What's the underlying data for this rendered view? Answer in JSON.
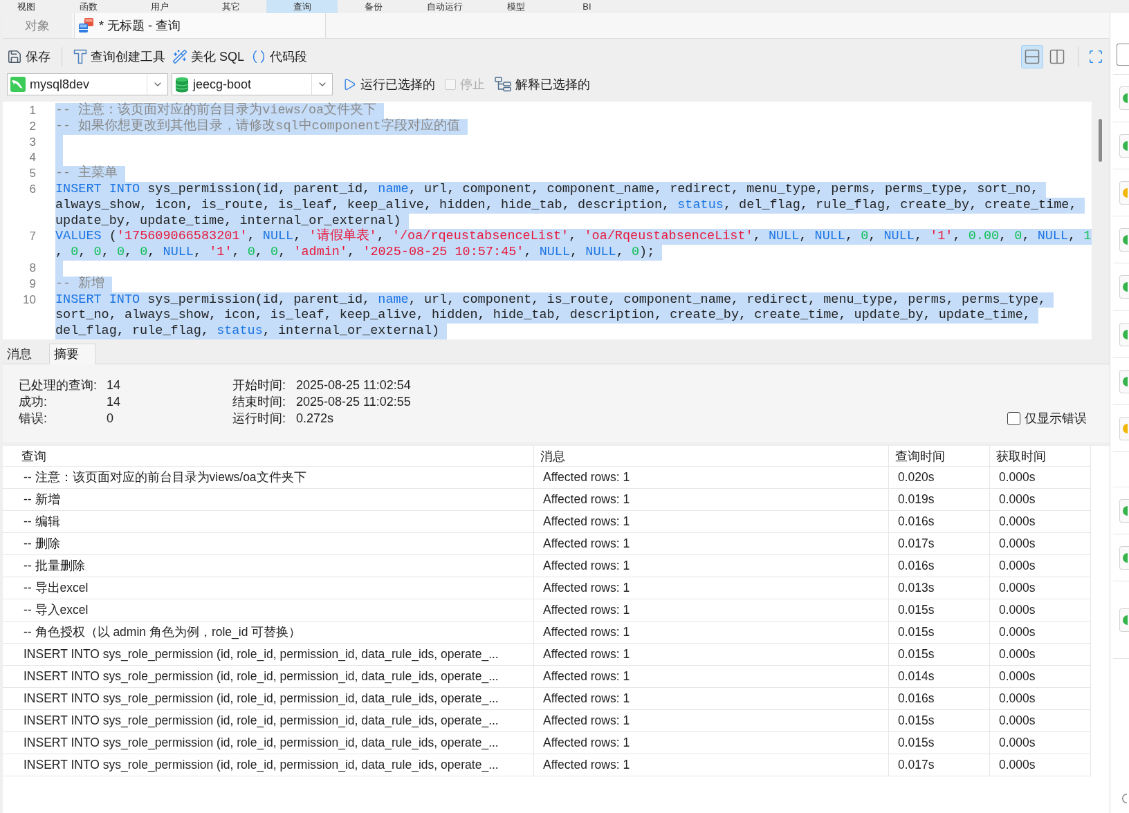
{
  "menu_bar": {
    "items": [
      {
        "label": "视图",
        "selected": false
      },
      {
        "label": "函数",
        "selected": false
      },
      {
        "label": "用户",
        "selected": false
      },
      {
        "label": "其它",
        "selected": false
      },
      {
        "label": "查询",
        "selected": true
      },
      {
        "label": "备份",
        "selected": false
      },
      {
        "label": "自动运行",
        "selected": false
      },
      {
        "label": "模型",
        "selected": false
      },
      {
        "label": "BI",
        "selected": false
      }
    ]
  },
  "document_tabs": [
    {
      "kind": "objects",
      "label": "对象",
      "selected": false
    },
    {
      "kind": "query",
      "label": "* 无标题 - 查询",
      "selected": true
    }
  ],
  "toolbar": {
    "buttons": [
      {
        "kind": "save",
        "label": "保存"
      },
      {
        "kind": "builder",
        "label": "查询创建工具"
      },
      {
        "kind": "beautify",
        "label": "美化 SQL"
      },
      {
        "kind": "snippet",
        "label": "代码段"
      }
    ],
    "layout_buttons": [
      {
        "kind": "split-horizontal",
        "selected": true
      },
      {
        "kind": "split-vertical",
        "selected": false
      }
    ]
  },
  "query_bar": {
    "connection": "mysql8dev",
    "database": "jeecg-boot",
    "actions": [
      {
        "kind": "run",
        "label": "运行已选择的",
        "disabled": false
      },
      {
        "kind": "stop",
        "label": "停止",
        "disabled": true
      },
      {
        "kind": "explain",
        "label": "解释已选择的",
        "disabled": false
      }
    ]
  },
  "editor": {
    "selected": true,
    "lines": [
      {
        "number": "1",
        "wrapped_lines": [
          {
            "spans": [
              {
                "kind": "comment",
                "text": "-- 注意：该页面对应的前台目录为views/oa文件夹下"
              }
            ]
          }
        ]
      },
      {
        "number": "2",
        "wrapped_lines": [
          {
            "spans": [
              {
                "kind": "comment",
                "text": "-- 如果你想更改到其他目录，请修改sql中component字段对应的值"
              }
            ]
          }
        ]
      },
      {
        "number": "3"
      },
      {
        "number": "4"
      },
      {
        "number": "5",
        "wrapped_lines": [
          {
            "spans": [
              {
                "kind": "comment",
                "text": "-- 主菜单"
              }
            ]
          }
        ]
      },
      {
        "number": "6",
        "wrapped_lines": [
          {
            "spans": [
              {
                "kind": "keyword",
                "text": "INSERT INTO"
              },
              {
                "kind": "plain",
                "text": " sys_permission(id, parent_id, "
              },
              {
                "kind": "keyword",
                "text": "name"
              },
              {
                "kind": "plain",
                "text": ", url, component, component_name, redirect, menu_type, perms, perms_type, sort_no,"
              }
            ]
          },
          {
            "spans": [
              {
                "kind": "plain",
                "text": "always_show, icon, is_route, is_leaf, keep_alive, hidden, hide_tab, description, "
              },
              {
                "kind": "keyword",
                "text": "status"
              },
              {
                "kind": "plain",
                "text": ", del_flag, rule_flag, create_by, create_time,"
              }
            ]
          },
          {
            "spans": [
              {
                "kind": "plain",
                "text": "update_by, update_time, internal_or_external)"
              }
            ]
          }
        ]
      },
      {
        "number": "7",
        "wrapped_lines": [
          {
            "spans": [
              {
                "kind": "keyword",
                "text": "VALUES"
              },
              {
                "kind": "plain",
                "text": " ("
              },
              {
                "kind": "string",
                "text": "'175609066583201'"
              },
              {
                "kind": "plain",
                "text": ", "
              },
              {
                "kind": "keyword",
                "text": "NULL"
              },
              {
                "kind": "plain",
                "text": ", "
              },
              {
                "kind": "string",
                "text": "'请假单表'"
              },
              {
                "kind": "plain",
                "text": ", "
              },
              {
                "kind": "string",
                "text": "'/oa/rqeustabsenceList'"
              },
              {
                "kind": "plain",
                "text": ", "
              },
              {
                "kind": "string",
                "text": "'oa/RqeustabsenceList'"
              },
              {
                "kind": "plain",
                "text": ", "
              },
              {
                "kind": "keyword",
                "text": "NULL"
              },
              {
                "kind": "plain",
                "text": ", "
              },
              {
                "kind": "keyword",
                "text": "NULL"
              },
              {
                "kind": "plain",
                "text": ", "
              },
              {
                "kind": "number",
                "text": "0"
              },
              {
                "kind": "plain",
                "text": ", "
              },
              {
                "kind": "keyword",
                "text": "NULL"
              },
              {
                "kind": "plain",
                "text": ", "
              },
              {
                "kind": "string",
                "text": "'1'"
              },
              {
                "kind": "plain",
                "text": ", "
              },
              {
                "kind": "number",
                "text": "0.00"
              },
              {
                "kind": "plain",
                "text": ", "
              },
              {
                "kind": "number",
                "text": "0"
              },
              {
                "kind": "plain",
                "text": ", "
              },
              {
                "kind": "keyword",
                "text": "NULL"
              },
              {
                "kind": "plain",
                "text": ", "
              },
              {
                "kind": "number",
                "text": "1"
              }
            ]
          },
          {
            "spans": [
              {
                "kind": "plain",
                "text": ", "
              },
              {
                "kind": "number",
                "text": "0"
              },
              {
                "kind": "plain",
                "text": ", "
              },
              {
                "kind": "number",
                "text": "0"
              },
              {
                "kind": "plain",
                "text": ", "
              },
              {
                "kind": "number",
                "text": "0"
              },
              {
                "kind": "plain",
                "text": ", "
              },
              {
                "kind": "number",
                "text": "0"
              },
              {
                "kind": "plain",
                "text": ", "
              },
              {
                "kind": "keyword",
                "text": "NULL"
              },
              {
                "kind": "plain",
                "text": ", "
              },
              {
                "kind": "string",
                "text": "'1'"
              },
              {
                "kind": "plain",
                "text": ", "
              },
              {
                "kind": "number",
                "text": "0"
              },
              {
                "kind": "plain",
                "text": ", "
              },
              {
                "kind": "number",
                "text": "0"
              },
              {
                "kind": "plain",
                "text": ", "
              },
              {
                "kind": "string",
                "text": "'admin'"
              },
              {
                "kind": "plain",
                "text": ", "
              },
              {
                "kind": "string",
                "text": "'2025-08-25 10:57:45'"
              },
              {
                "kind": "plain",
                "text": ", "
              },
              {
                "kind": "keyword",
                "text": "NULL"
              },
              {
                "kind": "plain",
                "text": ", "
              },
              {
                "kind": "keyword",
                "text": "NULL"
              },
              {
                "kind": "plain",
                "text": ", "
              },
              {
                "kind": "number",
                "text": "0"
              },
              {
                "kind": "plain",
                "text": ");"
              }
            ]
          }
        ]
      },
      {
        "number": "8"
      },
      {
        "number": "9",
        "wrapped_lines": [
          {
            "spans": [
              {
                "kind": "comment",
                "text": "-- 新增"
              }
            ]
          }
        ]
      },
      {
        "number": "10",
        "wrapped_lines": [
          {
            "spans": [
              {
                "kind": "keyword",
                "text": "INSERT INTO"
              },
              {
                "kind": "plain",
                "text": " sys_permission(id, parent_id, "
              },
              {
                "kind": "keyword",
                "text": "name"
              },
              {
                "kind": "plain",
                "text": ", url, component, is_route, component_name, redirect, menu_type, perms, perms_type,"
              }
            ]
          },
          {
            "spans": [
              {
                "kind": "plain",
                "text": "sort_no, always_show, icon, is_leaf, keep_alive, hidden, hide_tab, description, create_by, create_time, update_by, update_time,"
              }
            ]
          },
          {
            "spans": [
              {
                "kind": "plain",
                "text": "del_flag, rule_flag, "
              },
              {
                "kind": "keyword",
                "text": "status"
              },
              {
                "kind": "plain",
                "text": ", internal_or_external)"
              }
            ]
          }
        ]
      }
    ]
  },
  "result_tabs": [
    {
      "label": "消息",
      "selected": false
    },
    {
      "label": "摘要",
      "selected": true
    }
  ],
  "summary": {
    "stats": [
      {
        "label": "已处理的查询:",
        "value": "14"
      },
      {
        "label": "成功:",
        "value": "14"
      },
      {
        "label": "错误:",
        "value": "0"
      }
    ],
    "times": [
      {
        "label": "开始时间:",
        "value": "2025-08-25 11:02:54"
      },
      {
        "label": "结束时间:",
        "value": "2025-08-25 11:02:55"
      },
      {
        "label": "运行时间:",
        "value": "0.272s"
      }
    ],
    "errors_only": {
      "label": "仅显示错误",
      "checked": false
    }
  },
  "results_table": {
    "columns": [
      "查询",
      "消息",
      "查询时间",
      "获取时间"
    ],
    "rows": [
      {
        "query": "-- 注意：该页面对应的前台目录为views/oa文件夹下",
        "message": "Affected rows: 1",
        "query_time": "0.020s",
        "fetch_time": "0.000s"
      },
      {
        "query": "-- 新增",
        "message": "Affected rows: 1",
        "query_time": "0.019s",
        "fetch_time": "0.000s"
      },
      {
        "query": "-- 编辑",
        "message": "Affected rows: 1",
        "query_time": "0.016s",
        "fetch_time": "0.000s"
      },
      {
        "query": "-- 删除",
        "message": "Affected rows: 1",
        "query_time": "0.017s",
        "fetch_time": "0.000s"
      },
      {
        "query": "-- 批量删除",
        "message": "Affected rows: 1",
        "query_time": "0.016s",
        "fetch_time": "0.000s"
      },
      {
        "query": "-- 导出excel",
        "message": "Affected rows: 1",
        "query_time": "0.013s",
        "fetch_time": "0.000s"
      },
      {
        "query": "-- 导入excel",
        "message": "Affected rows: 1",
        "query_time": "0.015s",
        "fetch_time": "0.000s"
      },
      {
        "query": "-- 角色授权（以 admin 角色为例，role_id 可替换）",
        "message": "Affected rows: 1",
        "query_time": "0.015s",
        "fetch_time": "0.000s"
      },
      {
        "query": "INSERT INTO sys_role_permission (id, role_id, permission_id, data_rule_ids, operate_...",
        "message": "Affected rows: 1",
        "query_time": "0.015s",
        "fetch_time": "0.000s"
      },
      {
        "query": "INSERT INTO sys_role_permission (id, role_id, permission_id, data_rule_ids, operate_...",
        "message": "Affected rows: 1",
        "query_time": "0.014s",
        "fetch_time": "0.000s"
      },
      {
        "query": "INSERT INTO sys_role_permission (id, role_id, permission_id, data_rule_ids, operate_...",
        "message": "Affected rows: 1",
        "query_time": "0.016s",
        "fetch_time": "0.000s"
      },
      {
        "query": "INSERT INTO sys_role_permission (id, role_id, permission_id, data_rule_ids, operate_...",
        "message": "Affected rows: 1",
        "query_time": "0.015s",
        "fetch_time": "0.000s"
      },
      {
        "query": "INSERT INTO sys_role_permission (id, role_id, permission_id, data_rule_ids, operate_...",
        "message": "Affected rows: 1",
        "query_time": "0.015s",
        "fetch_time": "0.000s"
      },
      {
        "query": "INSERT INTO sys_role_permission (id, role_id, permission_id, data_rule_ids, operate_...",
        "message": "Affected rows: 1",
        "query_time": "0.017s",
        "fetch_time": "0.000s"
      }
    ]
  },
  "side_panel": {
    "items": [
      {
        "color": "#34b44a"
      },
      {
        "color": "#34b44a"
      },
      {
        "color": "#f2b705"
      },
      {
        "color": "#34b44a"
      },
      {
        "color": "#34b44a"
      },
      {
        "color": "#34b44a"
      },
      {
        "color": "#34b44a"
      },
      {
        "color": "#f2b705"
      },
      {
        "color": "#34b44a"
      },
      {
        "color": "#34b44a"
      },
      {
        "color": "#34b44a"
      }
    ]
  }
}
